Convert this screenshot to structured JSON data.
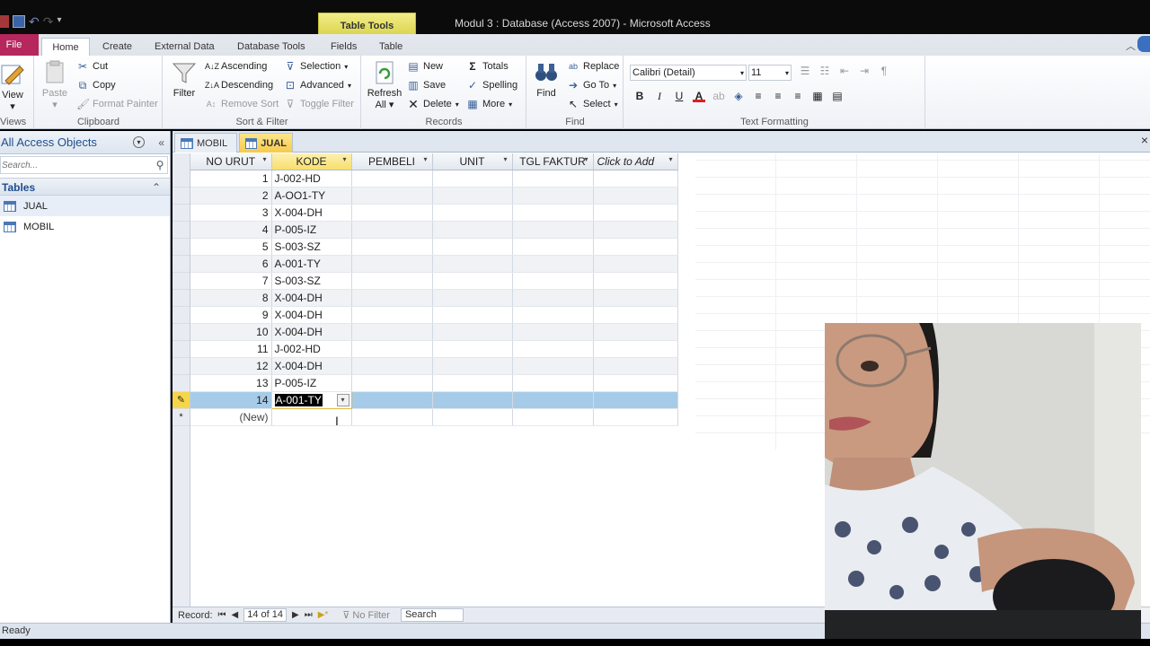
{
  "window": {
    "title": "Modul 3 : Database (Access 2007)  -  Microsoft Access",
    "contextual_tab": "Table Tools"
  },
  "ribbon_tabs": {
    "file": "File",
    "home": "Home",
    "create": "Create",
    "external": "External Data",
    "dbtools": "Database Tools",
    "fields": "Fields",
    "table": "Table"
  },
  "ribbon": {
    "views": {
      "view": "View",
      "group": "Views"
    },
    "clipboard": {
      "paste": "Paste",
      "cut": "Cut",
      "copy": "Copy",
      "format_painter": "Format Painter",
      "group": "Clipboard"
    },
    "sort_filter": {
      "filter": "Filter",
      "ascending": "Ascending",
      "descending": "Descending",
      "remove_sort": "Remove Sort",
      "selection": "Selection",
      "advanced": "Advanced",
      "toggle_filter": "Toggle Filter",
      "group": "Sort & Filter"
    },
    "records": {
      "refresh_line1": "Refresh",
      "refresh_line2": "All",
      "new": "New",
      "save": "Save",
      "delete": "Delete",
      "totals": "Totals",
      "spelling": "Spelling",
      "more": "More",
      "group": "Records"
    },
    "find": {
      "find": "Find",
      "replace": "Replace",
      "goto": "Go To",
      "select": "Select",
      "group": "Find"
    },
    "text_formatting": {
      "font": "Calibri (Detail)",
      "size": "11",
      "bold": "B",
      "italic": "I",
      "underline": "U",
      "font_color_letter": "A",
      "group": "Text Formatting"
    }
  },
  "nav_pane": {
    "title": "All Access Objects",
    "search_placeholder": "Search...",
    "group": "Tables",
    "items": [
      {
        "label": "JUAL"
      },
      {
        "label": "MOBIL"
      }
    ]
  },
  "doc_tabs": [
    {
      "label": "MOBIL"
    },
    {
      "label": "JUAL"
    }
  ],
  "datasheet": {
    "columns": [
      "NO URUT",
      "KODE",
      "PEMBELI",
      "UNIT",
      "TGL FAKTUR",
      "Click to Add"
    ],
    "rows": [
      {
        "no": "1",
        "kode": "J-002-HD"
      },
      {
        "no": "2",
        "kode": "A-OO1-TY"
      },
      {
        "no": "3",
        "kode": "X-004-DH"
      },
      {
        "no": "4",
        "kode": "P-005-IZ"
      },
      {
        "no": "5",
        "kode": "S-003-SZ"
      },
      {
        "no": "6",
        "kode": "A-001-TY"
      },
      {
        "no": "7",
        "kode": "S-003-SZ"
      },
      {
        "no": "8",
        "kode": "X-004-DH"
      },
      {
        "no": "9",
        "kode": "X-004-DH"
      },
      {
        "no": "10",
        "kode": "X-004-DH"
      },
      {
        "no": "11",
        "kode": "J-002-HD"
      },
      {
        "no": "12",
        "kode": "X-004-DH"
      },
      {
        "no": "13",
        "kode": "P-005-IZ"
      },
      {
        "no": "14",
        "kode": "A-001-TY"
      }
    ],
    "new_row_label": "(New)"
  },
  "record_nav": {
    "label": "Record:",
    "position": "14 of 14",
    "filter": "No Filter",
    "search": "Search"
  },
  "status": {
    "text": "Ready"
  },
  "colors": {
    "file_tab": "#b6275d",
    "contextual_tab": "#e8e26a",
    "selected_row": "#a6cbe8",
    "accent": "#1f4e8c"
  }
}
